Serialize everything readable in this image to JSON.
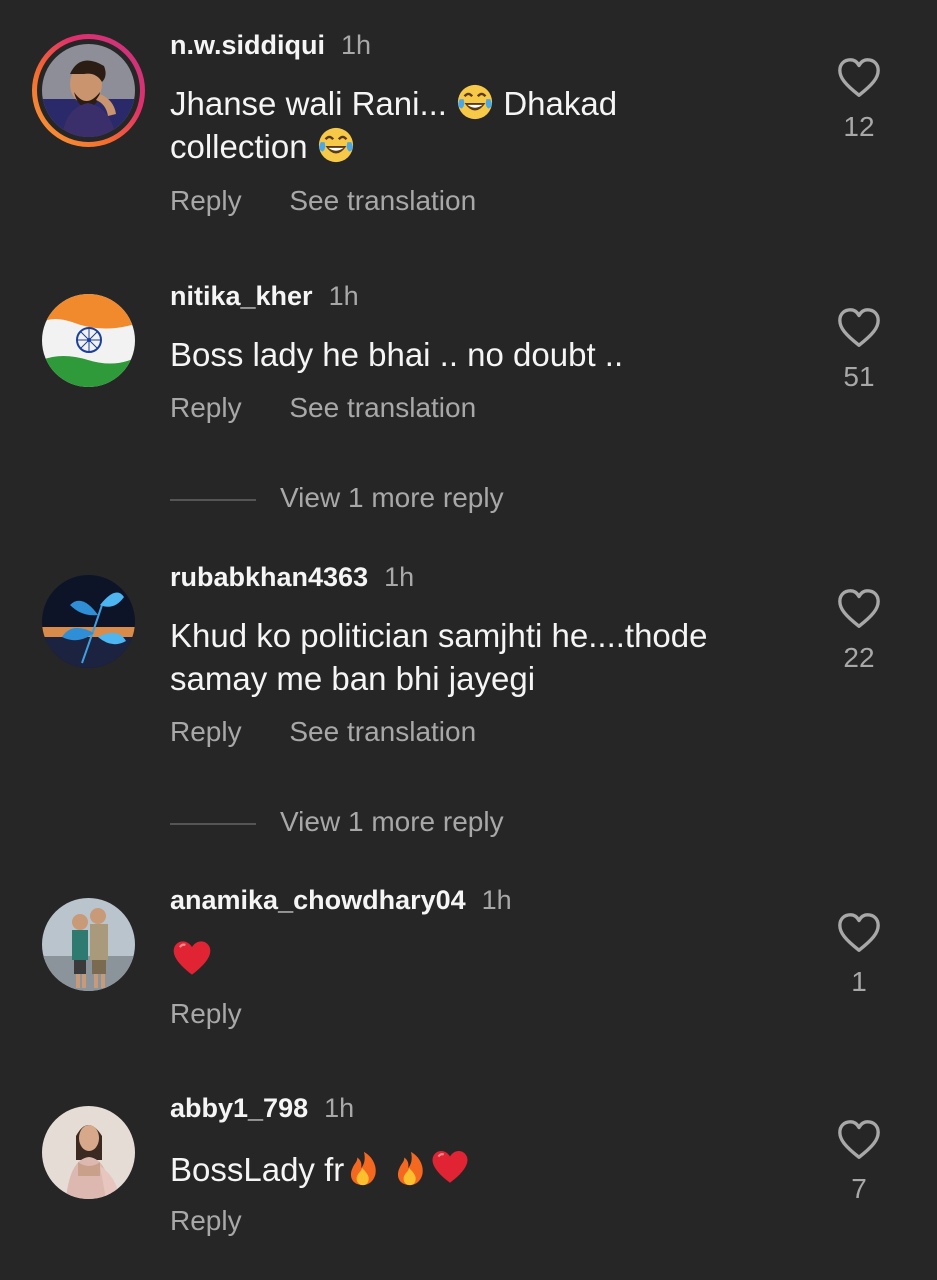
{
  "comments": [
    {
      "username": "n.w.siddiqui",
      "time": "1h",
      "text_parts": [
        "Jhanse wali Rani... ",
        " Dhakad collection "
      ],
      "line1": "Jhanse wali Rani...",
      "line1b": "Dhakad",
      "line2": "collection",
      "likes": "12",
      "reply": "Reply",
      "translate": "See translation",
      "avatar_icon": "profile-photo-man-icon"
    },
    {
      "username": "nitika_kher",
      "time": "1h",
      "line1": "Boss lady he bhai .. no doubt ..",
      "likes": "51",
      "reply": "Reply",
      "translate": "See translation",
      "view_more": "View 1 more reply",
      "avatar_icon": "indian-flag-icon"
    },
    {
      "username": "rubabkhan4363",
      "time": "1h",
      "line1": "Khud ko politician samjhti he....thode",
      "line2": "samay me ban bhi jayegi",
      "likes": "22",
      "reply": "Reply",
      "translate": "See translation",
      "view_more": "View 1 more reply",
      "avatar_icon": "blue-leaf-icon"
    },
    {
      "username": "anamika_chowdhary04",
      "time": "1h",
      "likes": "1",
      "reply": "Reply",
      "avatar_icon": "couple-photo-icon"
    },
    {
      "username": "abby1_798",
      "time": "1h",
      "line1": "BossLady fr",
      "likes": "7",
      "reply": "Reply",
      "avatar_icon": "woman-photo-icon"
    }
  ],
  "icons": {
    "like": "heart-outline-icon",
    "emoji_laugh": "tears-of-joy-emoji",
    "emoji_heart": "red-heart-emoji",
    "emoji_fire": "fire-emoji"
  },
  "colors": {
    "background": "#262626",
    "primary_text": "#f5f5f5",
    "secondary_text": "#a8a8a8"
  }
}
